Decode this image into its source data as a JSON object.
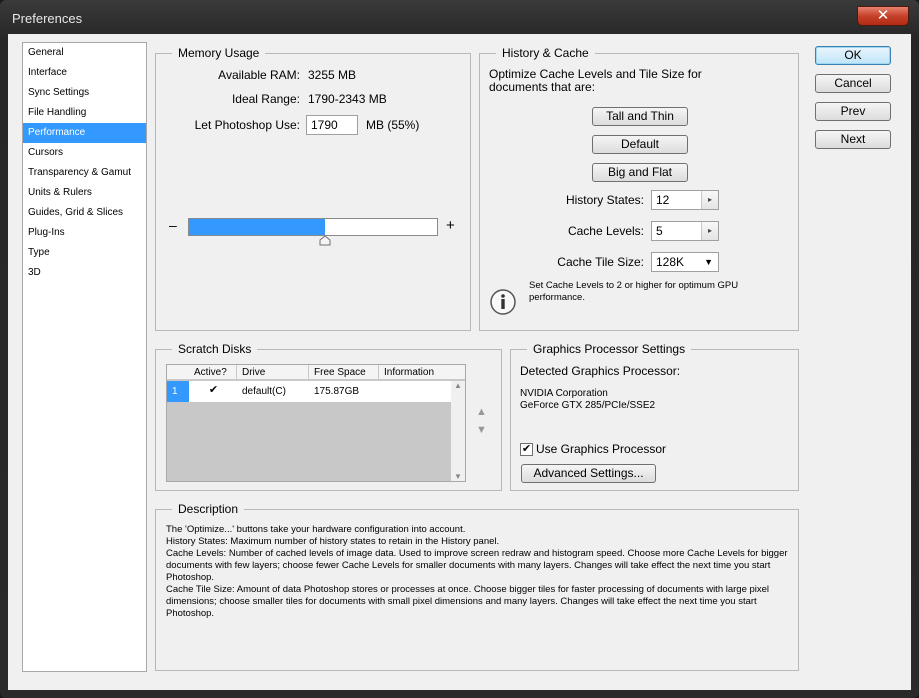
{
  "window": {
    "title": "Preferences",
    "close_glyph": "✕"
  },
  "nav": {
    "items": [
      "General",
      "Interface",
      "Sync Settings",
      "File Handling",
      "Performance",
      "Cursors",
      "Transparency & Gamut",
      "Units & Rulers",
      "Guides, Grid & Slices",
      "Plug-Ins",
      "Type",
      "3D"
    ],
    "active_index": 4
  },
  "actions": {
    "ok": "OK",
    "cancel": "Cancel",
    "prev": "Prev",
    "next": "Next"
  },
  "memory": {
    "title": "Memory Usage",
    "available_label": "Available RAM:",
    "available_value": "3255 MB",
    "ideal_label": "Ideal Range:",
    "ideal_value": "1790-2343 MB",
    "use_label": "Let Photoshop Use:",
    "use_value": "1790",
    "use_suffix": "MB (55%)",
    "minus": "–",
    "plus": "+",
    "slider_fraction": 0.55
  },
  "history": {
    "title": "History & Cache",
    "intro": "Optimize Cache Levels and Tile Size for documents that are:",
    "tall_thin": "Tall and Thin",
    "default": "Default",
    "big_flat": "Big and Flat",
    "states_label": "History States:",
    "states_value": "12",
    "levels_label": "Cache Levels:",
    "levels_value": "5",
    "tile_label": "Cache Tile Size:",
    "tile_value": "128K",
    "info_note": "Set Cache Levels to 2 or higher for optimum GPU performance."
  },
  "scratch": {
    "title": "Scratch Disks",
    "columns": [
      "Active?",
      "Drive",
      "Free Space",
      "Information"
    ],
    "rows": [
      {
        "index": "1",
        "active": "✔",
        "drive": "default(C)",
        "free": "175.87GB",
        "info": ""
      }
    ]
  },
  "gpu": {
    "title": "Graphics Processor Settings",
    "detected_label": "Detected Graphics Processor:",
    "vendor": "NVIDIA Corporation",
    "model": "GeForce GTX 285/PCIe/SSE2",
    "use_label": "Use Graphics Processor",
    "use_checked": "✔",
    "advanced": "Advanced Settings..."
  },
  "description": {
    "title": "Description",
    "lines": [
      "The 'Optimize...' buttons take your hardware configuration into account.",
      "History States: Maximum number of history states to retain in the History panel.",
      "Cache Levels: Number of cached levels of image data.  Used to improve screen redraw and histogram speed.  Choose more Cache Levels for bigger documents with few layers; choose fewer Cache Levels for smaller documents with many layers. Changes will take effect the next time you start Photoshop.",
      "Cache Tile Size: Amount of data Photoshop stores or processes at once. Choose bigger tiles for faster processing of documents with large pixel dimensions; choose smaller tiles for documents with small pixel dimensions and many layers. Changes will take effect the next time you start Photoshop."
    ]
  }
}
